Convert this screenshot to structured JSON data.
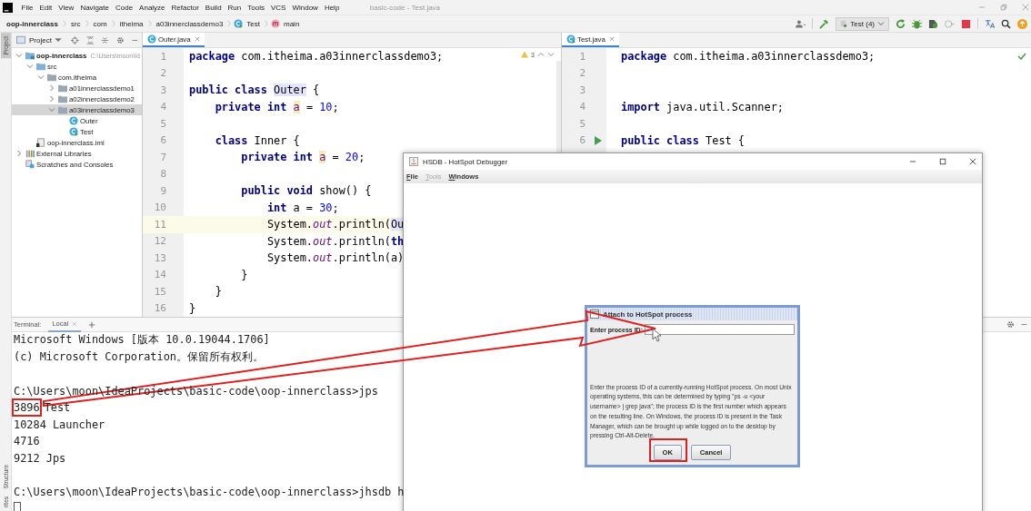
{
  "window": {
    "title": "basic-code - Test.java",
    "menu": [
      "File",
      "Edit",
      "View",
      "Navigate",
      "Code",
      "Analyze",
      "Refactor",
      "Build",
      "Run",
      "Tools",
      "VCS",
      "Window",
      "Help"
    ]
  },
  "navigation_bar": {
    "breadcrumbs": [
      {
        "label": "oop-innerclass",
        "kind": "project"
      },
      {
        "label": "src",
        "kind": "folder"
      },
      {
        "label": "com",
        "kind": "folder"
      },
      {
        "label": "itheima",
        "kind": "folder"
      },
      {
        "label": "a03innerclassdemo3",
        "kind": "folder"
      },
      {
        "label": "Test",
        "kind": "class"
      },
      {
        "label": "main",
        "kind": "method"
      }
    ],
    "run_configuration": "Test (4)"
  },
  "left_stripe": {
    "top": [
      {
        "label": "Project",
        "selected": true
      }
    ],
    "bottom": [
      {
        "label": "Structure",
        "selected": false
      },
      {
        "label": "rites",
        "selected": false
      }
    ]
  },
  "project_panel": {
    "title": "Project",
    "tree": [
      {
        "label": "oop-innerclass",
        "note": "C:\\Users\\moon\\Id",
        "kind": "module",
        "expanded": true,
        "selected": false,
        "children": [
          {
            "label": "src",
            "kind": "source",
            "expanded": true,
            "selected": false,
            "children": [
              {
                "label": "com.itheima",
                "kind": "package",
                "expanded": true,
                "selected": false,
                "children": [
                  {
                    "label": "a01innerclassdemo1",
                    "kind": "package",
                    "expanded": false,
                    "selected": false
                  },
                  {
                    "label": "a02innerclassdemo2",
                    "kind": "package",
                    "expanded": false,
                    "selected": false
                  },
                  {
                    "label": "a03innerclassdemo3",
                    "kind": "package",
                    "expanded": true,
                    "selected": true,
                    "children": [
                      {
                        "label": "Outer",
                        "kind": "class",
                        "selected": false
                      },
                      {
                        "label": "Test",
                        "kind": "main-class",
                        "selected": false
                      }
                    ]
                  }
                ]
              }
            ]
          },
          {
            "label": "oop-innerclass.iml",
            "kind": "iml",
            "selected": false
          }
        ]
      },
      {
        "label": "External Libraries",
        "kind": "libraries",
        "expanded": false,
        "selected": false
      },
      {
        "label": "Scratches and Consoles",
        "kind": "scratches",
        "selected": false
      }
    ]
  },
  "editors": [
    {
      "tab": {
        "label": "Outer.java",
        "selected": true
      },
      "warnings": "3",
      "lines": [
        {
          "number": "1",
          "current": false,
          "tokens": [
            {
              "kind": "keyword",
              "text": "package"
            },
            {
              "kind": "plain",
              "text": " com.itheima.a03innerclassdemo3;"
            }
          ]
        },
        {
          "number": "2",
          "current": false
        },
        {
          "number": "3",
          "current": false,
          "tokens": [
            {
              "kind": "keyword",
              "text": "public class "
            },
            {
              "kind": "highlight",
              "text": "Outer"
            },
            {
              "kind": "plain",
              "text": " {"
            }
          ]
        },
        {
          "number": "4",
          "current": false,
          "tokens": [
            {
              "kind": "keyword",
              "text": "    private int "
            },
            {
              "kind": "field",
              "text": "a"
            },
            {
              "kind": "plain",
              "text": " = "
            },
            {
              "kind": "number",
              "text": "10"
            },
            {
              "kind": "plain",
              "text": ";"
            }
          ]
        },
        {
          "number": "5",
          "current": false
        },
        {
          "number": "6",
          "current": false,
          "tokens": [
            {
              "kind": "keyword",
              "text": "    class "
            },
            {
              "kind": "plain",
              "text": "Inner {"
            }
          ]
        },
        {
          "number": "7",
          "current": false,
          "tokens": [
            {
              "kind": "keyword",
              "text": "        private int "
            },
            {
              "kind": "field",
              "text": "a"
            },
            {
              "kind": "plain",
              "text": " = "
            },
            {
              "kind": "number",
              "text": "20"
            },
            {
              "kind": "plain",
              "text": ";"
            }
          ]
        },
        {
          "number": "8",
          "current": false
        },
        {
          "number": "9",
          "current": false,
          "tokens": [
            {
              "kind": "keyword",
              "text": "        public void "
            },
            {
              "kind": "plain",
              "text": "show() {"
            }
          ]
        },
        {
          "number": "10",
          "current": false,
          "tokens": [
            {
              "kind": "keyword",
              "text": "            int "
            },
            {
              "kind": "plain",
              "text": "a = "
            },
            {
              "kind": "number",
              "text": "30"
            },
            {
              "kind": "plain",
              "text": ";"
            }
          ]
        },
        {
          "number": "11",
          "current": true,
          "tokens": [
            {
              "kind": "plain",
              "text": "            System."
            },
            {
              "kind": "static",
              "text": "out"
            },
            {
              "kind": "plain",
              "text": ".println("
            },
            {
              "kind": "highlight",
              "text": "Ou"
            }
          ]
        },
        {
          "number": "12",
          "current": false,
          "tokens": [
            {
              "kind": "plain",
              "text": "            System."
            },
            {
              "kind": "static",
              "text": "out"
            },
            {
              "kind": "plain",
              "text": ".println("
            },
            {
              "kind": "keyword",
              "text": "th"
            }
          ]
        },
        {
          "number": "13",
          "current": false,
          "tokens": [
            {
              "kind": "plain",
              "text": "            System."
            },
            {
              "kind": "static",
              "text": "out"
            },
            {
              "kind": "plain",
              "text": ".println(a)"
            }
          ]
        },
        {
          "number": "14",
          "current": false,
          "tokens": [
            {
              "kind": "plain",
              "text": "        }"
            }
          ]
        },
        {
          "number": "15",
          "current": false,
          "tokens": [
            {
              "kind": "plain",
              "text": "    }"
            }
          ]
        },
        {
          "number": "16",
          "current": false,
          "tokens": [
            {
              "kind": "plain",
              "text": "}"
            }
          ]
        }
      ]
    },
    {
      "tab": {
        "label": "Test.java",
        "selected": true
      },
      "inspection_ok": true,
      "lines": [
        {
          "number": "1",
          "current": false,
          "run": false,
          "tokens": [
            {
              "kind": "keyword",
              "text": "package"
            },
            {
              "kind": "plain",
              "text": " com.itheima.a03innerclassdemo3;"
            }
          ]
        },
        {
          "number": "2",
          "current": false,
          "run": false
        },
        {
          "number": "3",
          "current": false,
          "run": false
        },
        {
          "number": "4",
          "current": false,
          "run": false,
          "tokens": [
            {
              "kind": "keyword",
              "text": "import"
            },
            {
              "kind": "plain",
              "text": " java.util.Scanner;"
            }
          ]
        },
        {
          "number": "5",
          "current": false,
          "run": false
        },
        {
          "number": "6",
          "current": false,
          "run": true,
          "tokens": [
            {
              "kind": "keyword",
              "text": "public class "
            },
            {
              "kind": "plain",
              "text": "Test {"
            }
          ]
        }
      ]
    }
  ],
  "terminal": {
    "title": "Terminal:",
    "tabs": [
      {
        "label": "Local",
        "selected": true
      }
    ],
    "blocks": [
      [
        "Microsoft Windows [版本 10.0.19044.1706]",
        "(c) Microsoft Corporation。保留所有权利。"
      ],
      [
        "C:\\Users\\moon\\IdeaProjects\\basic-code\\oop-innerclass>jps",
        [
          {
            "text": "3896",
            "framed": true
          },
          {
            "text": "Test",
            "framed": false
          }
        ],
        "10284 Launcher",
        "4716",
        "9212 Jps"
      ],
      [
        "C:\\Users\\moon\\IdeaProjects\\basic-code\\oop-innerclass>jhsdb h"
      ]
    ],
    "cursor": true
  },
  "debugger_window": {
    "title": "HSDB - HotSpot Debugger",
    "menu": [
      {
        "label": "File",
        "disabled": false
      },
      {
        "label": "Tools",
        "disabled": true
      },
      {
        "label": "Windows",
        "disabled": false
      }
    ]
  },
  "attach_dialog": {
    "title": "Attach to HotSpot process",
    "field_label": "Enter process ID:",
    "message": "Enter the process ID of a currently-running HotSpot process. On most Unix operating systems, this can be determined by typing \"ps -u <your username> | grep java\"; the process ID is the first number which appears on the resulting line. On Windows, the process ID is present in the Task Manager, which can be brought up while logged on to the desktop by pressing Ctrl-Alt-Delete.",
    "buttons": [
      "OK",
      "Cancel"
    ]
  }
}
